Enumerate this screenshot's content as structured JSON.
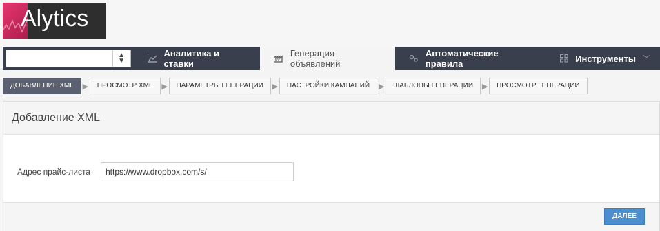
{
  "brand": {
    "logo_text": "Alytics",
    "accent": "#e4376e"
  },
  "site_select": {
    "value": "",
    "arrow_icon": "sort-arrows-icon"
  },
  "nav": {
    "items": [
      {
        "label": "Аналитика и ставки",
        "icon": "line-chart-icon",
        "active": false
      },
      {
        "label": "Генерация объявлений",
        "icon": "factory-icon",
        "active": true
      },
      {
        "label": "Автоматические правила",
        "icon": "gears-icon",
        "active": false
      },
      {
        "label": "Инструменты",
        "icon": "grid-icon",
        "active": false,
        "has_dropdown": true
      }
    ]
  },
  "steps": [
    {
      "label": "Добавление XML",
      "active": true
    },
    {
      "label": "Просмотр XML",
      "active": false
    },
    {
      "label": "Параметры генерации",
      "active": false
    },
    {
      "label": "Настройки кампаний",
      "active": false
    },
    {
      "label": "Шаблоны генерации",
      "active": false
    },
    {
      "label": "Просмотр генерации",
      "active": false
    }
  ],
  "panel": {
    "title": "Добавление XML",
    "price_list_label": "Адрес прайс-листа",
    "price_list_value": "https://www.dropbox.com/s/",
    "next_button": "Далее"
  }
}
